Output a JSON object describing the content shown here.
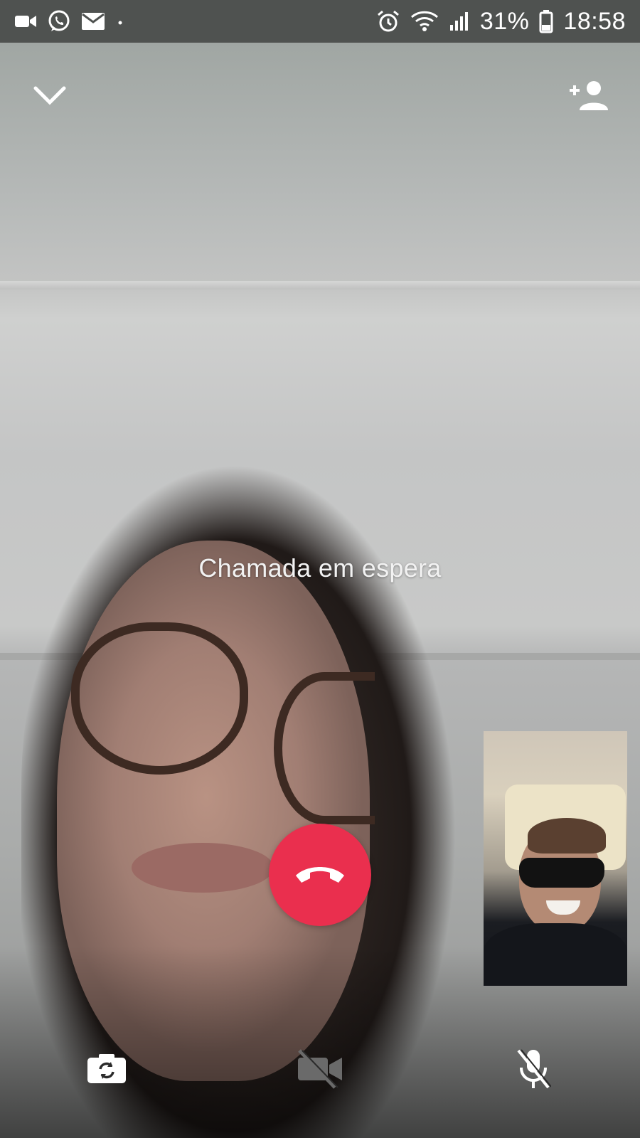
{
  "status_bar": {
    "time": "18:58",
    "battery": "31%",
    "left_icons": [
      "video-camera-icon",
      "whatsapp-icon",
      "mail-icon",
      "dot-icon"
    ],
    "right_icons": [
      "alarm-icon",
      "wifi-icon",
      "signal-icon",
      "battery-icon"
    ]
  },
  "top_bar": {
    "minimize_icon": "chevron-down-icon",
    "add_participant_icon": "add-person-icon"
  },
  "call": {
    "status_text": "Chamada em espera"
  },
  "controls": {
    "end_call_icon": "phone-hangup-icon",
    "end_call_color": "#ea2f4e",
    "switch_camera_icon": "switch-camera-icon",
    "video_off_icon": "video-off-icon",
    "mute_icon": "mic-off-icon"
  }
}
